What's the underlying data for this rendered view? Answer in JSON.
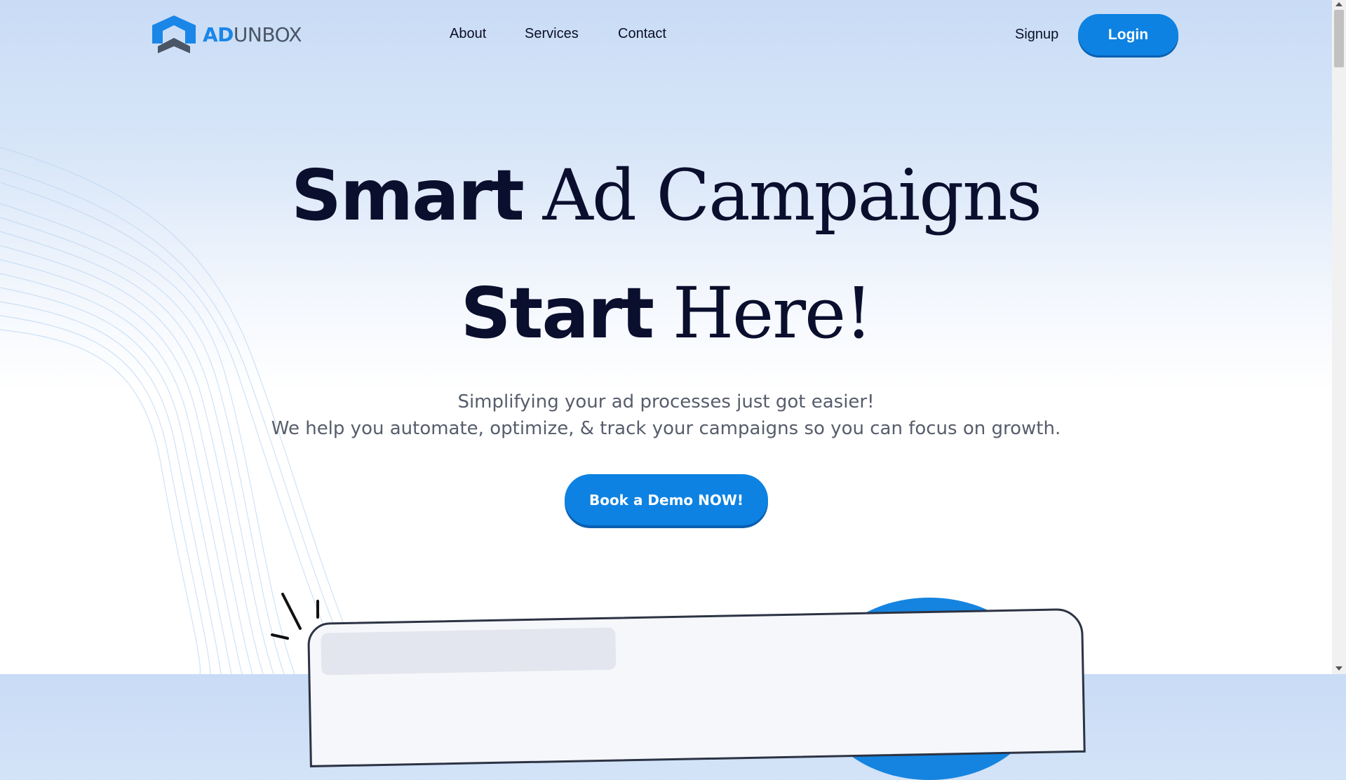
{
  "brand": {
    "name_part1": "AD",
    "name_part2": "UNBOX",
    "accent": "#1a86e8",
    "dark": "#4a5566"
  },
  "nav": {
    "items": [
      {
        "label": "About"
      },
      {
        "label": "Services"
      },
      {
        "label": "Contact"
      }
    ],
    "signup_label": "Signup",
    "login_label": "Login"
  },
  "hero": {
    "line1_bold": "Smart",
    "line1_serif": "Ad Campaigns",
    "line2_bold": "Start",
    "line2_serif": "Here!",
    "subtitle1": "Simplifying your ad processes just got easier!",
    "subtitle2": "We help you automate, optimize, & track your campaigns so you can focus on growth.",
    "cta_label": "Book a Demo NOW!"
  },
  "colors": {
    "primary": "#0d82e2",
    "heading": "#0b0f2e",
    "body_text": "#575d6b"
  },
  "icons": [
    "adunbox-logo-icon",
    "spark-lines-icon"
  ]
}
